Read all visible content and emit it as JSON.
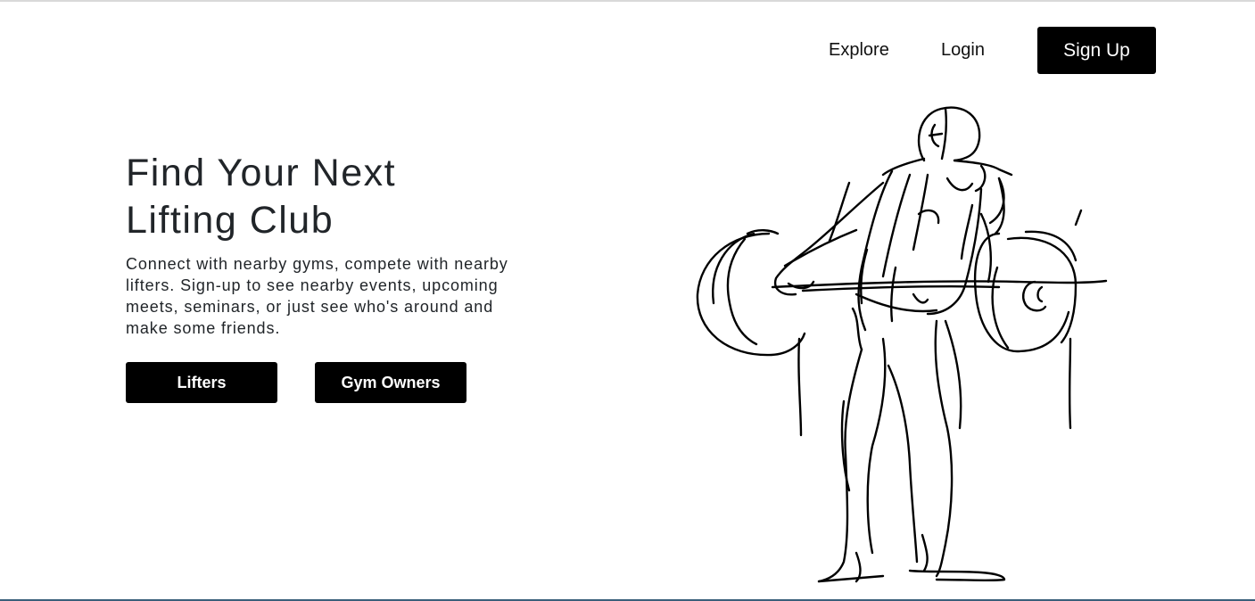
{
  "nav": {
    "explore_label": "Explore",
    "login_label": "Login",
    "signup_label": "Sign Up"
  },
  "hero": {
    "title": "Find Your Next Lifting Club",
    "description": "Connect with nearby gyms, compete with nearby lifters. Sign-up to see nearby events, upcoming meets, seminars, or just see who's around and make some friends.",
    "buttons": {
      "lifters_label": "Lifters",
      "gym_owners_label": "Gym Owners"
    },
    "illustration": "weightlifter-sketch"
  },
  "colors": {
    "button_bg": "#000000",
    "button_text": "#ffffff",
    "text": "#212529"
  }
}
